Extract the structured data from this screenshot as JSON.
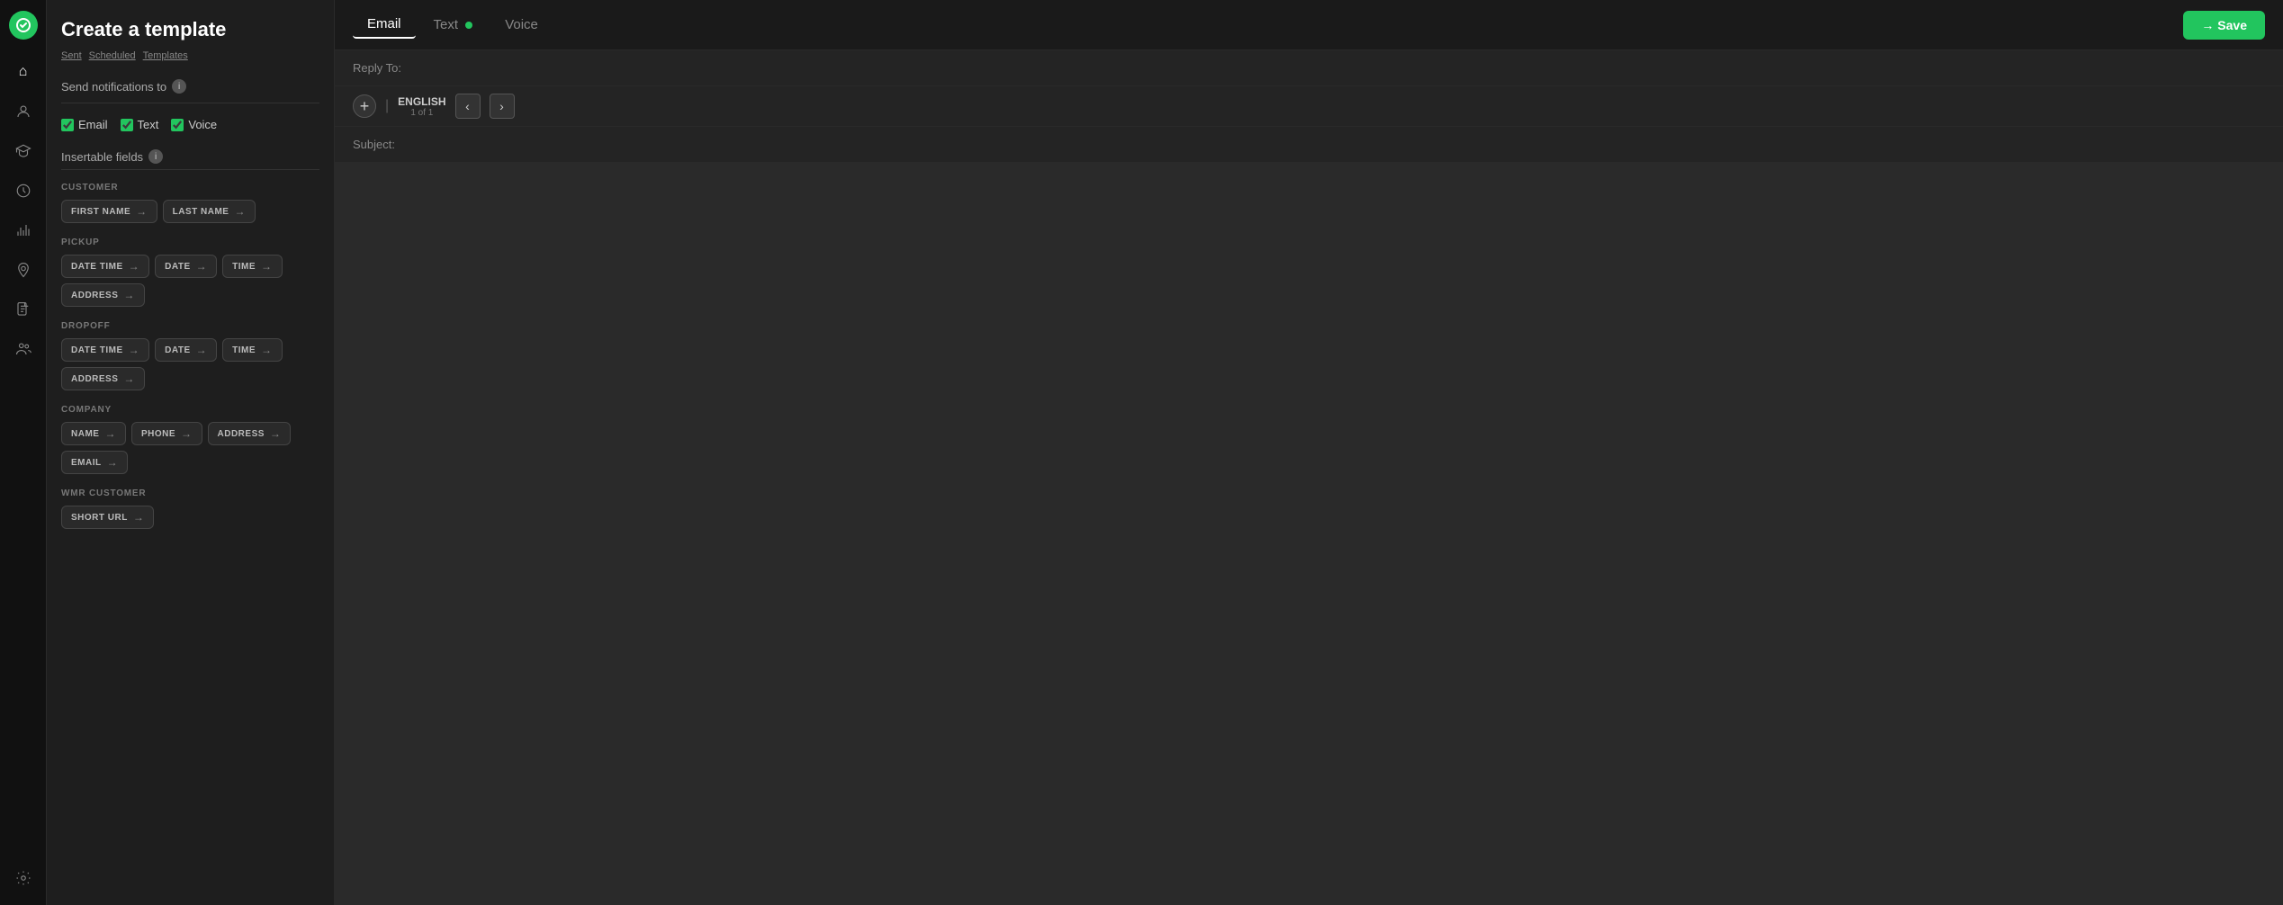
{
  "nav": {
    "items": [
      {
        "name": "home-icon",
        "symbol": "⌂"
      },
      {
        "name": "user-icon",
        "symbol": "👤"
      },
      {
        "name": "education-icon",
        "symbol": "🎓"
      },
      {
        "name": "history-icon",
        "symbol": "🕐"
      },
      {
        "name": "analytics-icon",
        "symbol": "📈"
      },
      {
        "name": "location-icon",
        "symbol": "📍"
      },
      {
        "name": "document-icon",
        "symbol": "📄"
      },
      {
        "name": "team-icon",
        "symbol": "👥"
      },
      {
        "name": "settings-icon",
        "symbol": "⚙"
      }
    ]
  },
  "sidebar": {
    "title": "Create a template",
    "breadcrumbs": [
      "Sent",
      "Scheduled",
      "Templates"
    ],
    "send_notifications_label": "Send notifications to",
    "checkboxes": [
      {
        "id": "email",
        "label": "Email",
        "checked": true
      },
      {
        "id": "text",
        "label": "Text",
        "checked": true
      },
      {
        "id": "voice",
        "label": "Voice",
        "checked": true
      }
    ],
    "insertable_fields_label": "Insertable fields",
    "categories": [
      {
        "name": "CUSTOMER",
        "fields": [
          {
            "label": "FIRST NAME"
          },
          {
            "label": "LAST NAME"
          }
        ]
      },
      {
        "name": "PICKUP",
        "fields": [
          {
            "label": "DATE TIME"
          },
          {
            "label": "DATE"
          },
          {
            "label": "TIME"
          },
          {
            "label": "ADDRESS"
          }
        ]
      },
      {
        "name": "DROPOFF",
        "fields": [
          {
            "label": "DATE TIME"
          },
          {
            "label": "DATE"
          },
          {
            "label": "TIME"
          },
          {
            "label": "ADDRESS"
          }
        ]
      },
      {
        "name": "COMPANY",
        "fields": [
          {
            "label": "NAME"
          },
          {
            "label": "PHONE"
          },
          {
            "label": "ADDRESS"
          },
          {
            "label": "EMAIL"
          }
        ]
      },
      {
        "name": "WMR CUSTOMER",
        "fields": [
          {
            "label": "SHORT URL"
          }
        ]
      }
    ]
  },
  "tabs": [
    {
      "label": "Email",
      "active": true
    },
    {
      "label": "Text",
      "active": false,
      "dot": true
    },
    {
      "label": "Voice",
      "active": false
    }
  ],
  "save_button": "→ Save",
  "editor": {
    "reply_to_label": "Reply To:",
    "reply_to_placeholder": "",
    "language": {
      "name": "ENGLISH",
      "current": "1",
      "total": "1"
    },
    "subject_label": "Subject:",
    "subject_placeholder": ""
  }
}
